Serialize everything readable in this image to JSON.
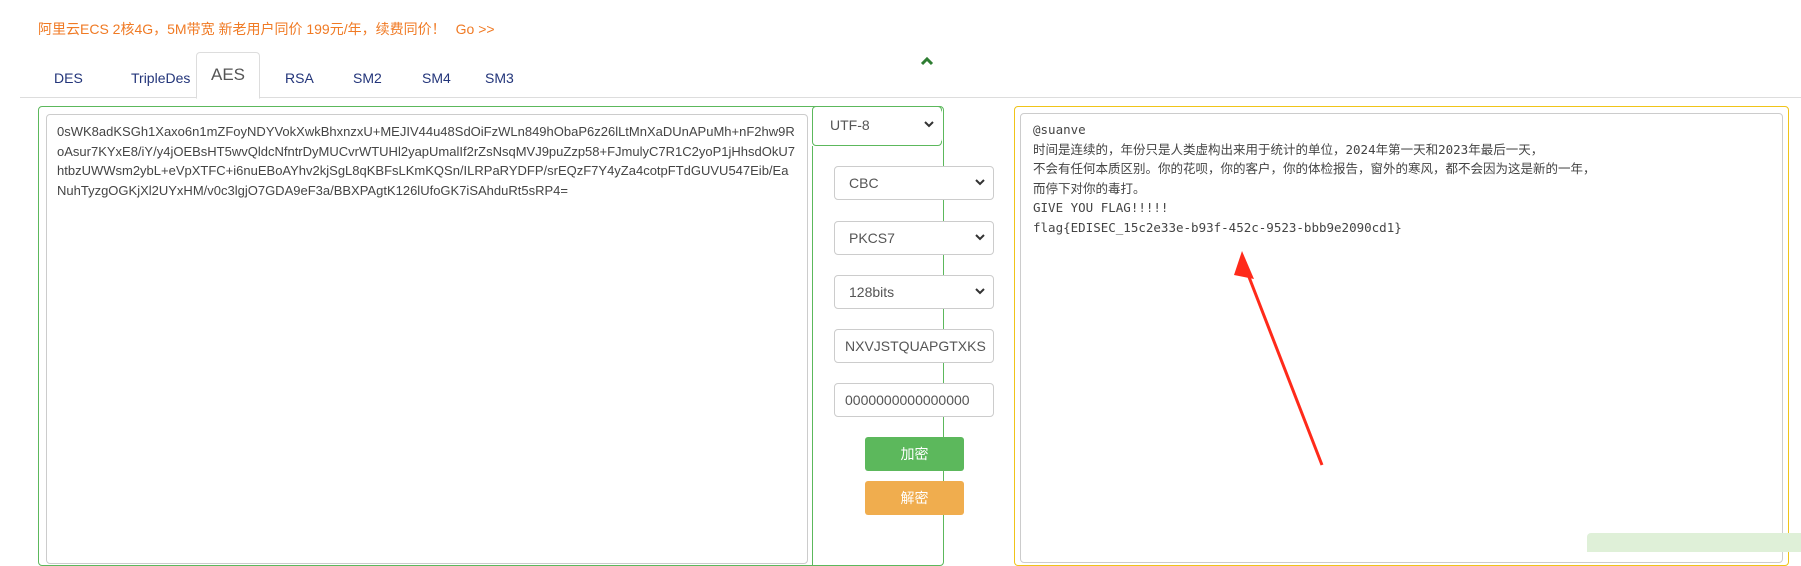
{
  "promo": {
    "text": "阿里云ECS 2核4G，5M带宽 新老用户同价 199元/年，续费同价！",
    "link": "Go >>"
  },
  "tabs": [
    {
      "label": "DES"
    },
    {
      "label": "TripleDes"
    },
    {
      "label": "AES",
      "active": true
    },
    {
      "label": "RSA"
    },
    {
      "label": "SM2"
    },
    {
      "label": "SM4"
    },
    {
      "label": "SM3"
    }
  ],
  "input": {
    "text": "0sWK8adKSGh1Xaxo6n1mZFoyNDYVokXwkBhxnzxU+MEJIV44u48SdOiFzWLn849hObaP6z26lLtMnXaDUnAPuMh+nF2hw9RoAsur7KYxE8/iY/y4jOEBsHT5wvQldcNfntrDyMUCvrWTUHl2yapUmalIf2rZsNsqMVJ9puZzp58+FJmulyC7R1C2yoP1jHhsdOkU7htbzUWWsm2ybL+eVpXTFC+i6nuEBoAYhv2kjSgL8qKBFsLKmKQSn/ILRPaRYDFP/srEQzF7Y4yZa4cotpFTdGUVU547Eib/EaNuhTyzgOGKjXl2UYxHM/v0c3lgjO7GDA9eF3a/BBXPAgtK126lUfoGK7iSAhduRt5sRP4="
  },
  "controls": {
    "encoding": "UTF-8",
    "mode": "CBC",
    "padding": "PKCS7",
    "bits": "128bits",
    "key": "NXVJSTQUAPGTXKS",
    "iv": "0000000000000000",
    "encrypt_label": "加密",
    "decrypt_label": "解密"
  },
  "output": {
    "lines": [
      "@suanve",
      "时间是连续的，年份只是人类虚构出来用于统计的单位，2024年第一天和2023年最后一天，",
      "不会有任何本质区别。你的花呗，你的客户，你的体检报告，窗外的寒风，都不会因为这是新的一年，",
      "而停下对你的毒打。",
      "GIVE YOU FLAG!!!!!",
      "flag{EDISEC_15c2e33e-b93f-452c-9523-bbb9e2090cd1}"
    ]
  },
  "colors": {
    "green": "#5cb85c",
    "orange": "#f0ad4e",
    "yellow_border": "#f0c419",
    "promo": "#f07a24",
    "arrow": "#ff2a1a"
  }
}
